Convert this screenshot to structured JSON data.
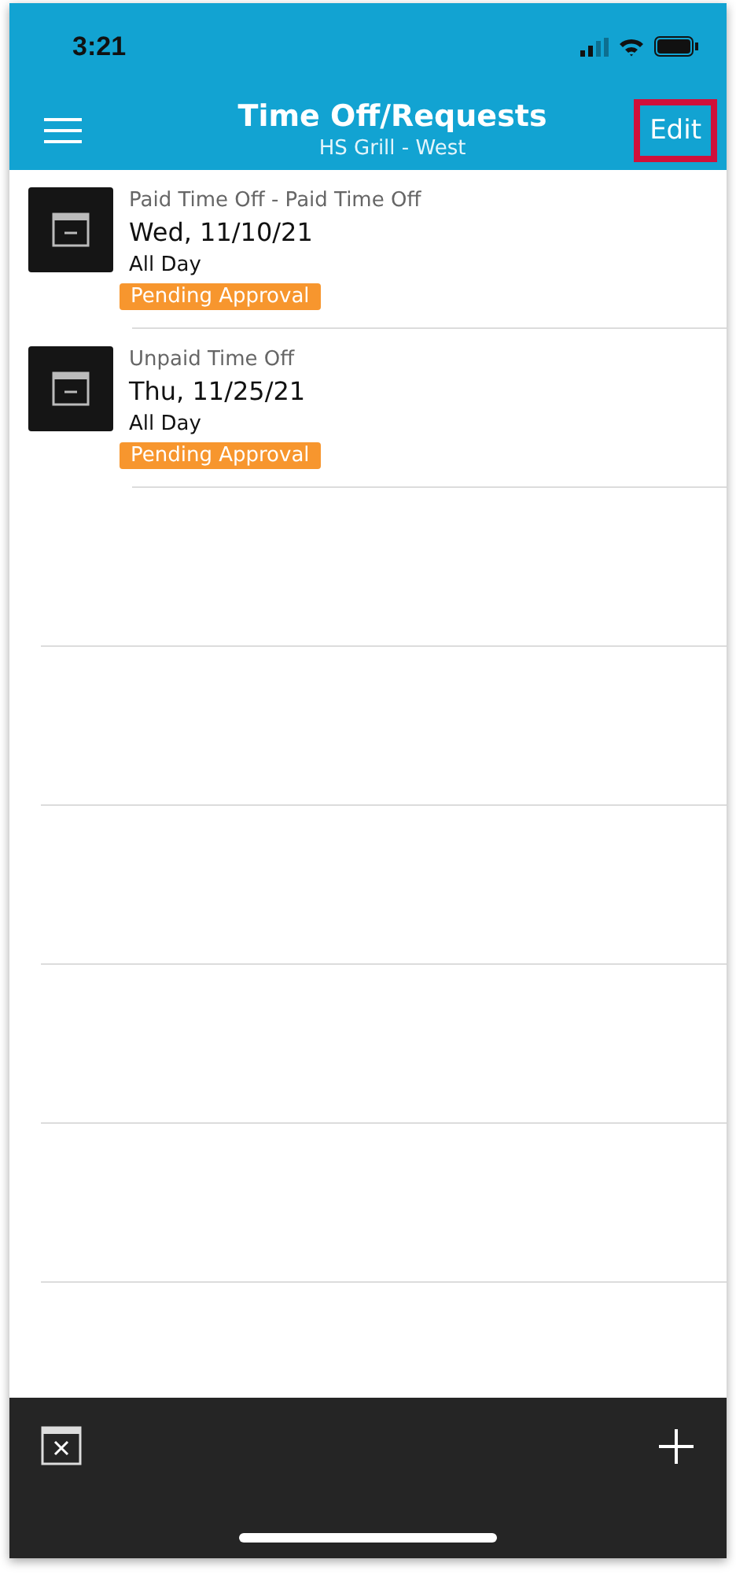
{
  "status_bar": {
    "time": "3:21"
  },
  "header": {
    "title": "Time Off/Requests",
    "subtitle": "HS Grill - West",
    "edit_button": {
      "label": "Edit",
      "highlighted": true
    }
  },
  "requests": [
    {
      "type": "Paid Time Off - Paid Time Off",
      "date": "Wed, 11/10/21",
      "duration": "All Day",
      "status": "Pending Approval"
    },
    {
      "type": "Unpaid Time Off",
      "date": "Thu, 11/25/21",
      "duration": "All Day",
      "status": "Pending Approval"
    }
  ]
}
